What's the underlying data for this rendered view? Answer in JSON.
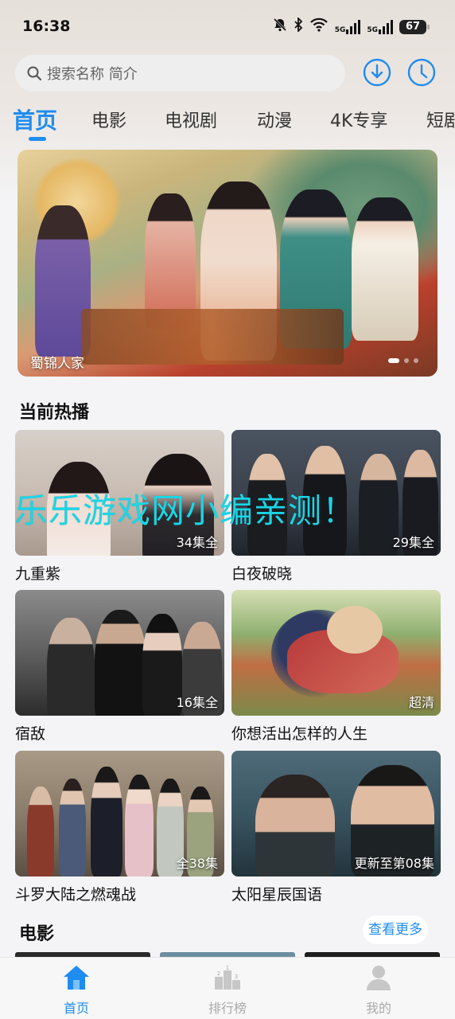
{
  "status_bar": {
    "time": "16:38",
    "net1": "5G",
    "net2": "5G",
    "battery": "67"
  },
  "search": {
    "placeholder": "搜索名称 简介"
  },
  "tabs": [
    {
      "label": "首页"
    },
    {
      "label": "电影"
    },
    {
      "label": "电视剧"
    },
    {
      "label": "动漫"
    },
    {
      "label": "4K专享"
    },
    {
      "label": "短剧"
    }
  ],
  "banner": {
    "caption": "蜀锦人家"
  },
  "section_hot": {
    "title": "当前热播"
  },
  "hot_items": [
    {
      "title": "九重紫",
      "badge": "34集全"
    },
    {
      "title": "白夜破晓",
      "badge": "29集全"
    },
    {
      "title": "宿敌",
      "badge": "16集全"
    },
    {
      "title": "你想活出怎样的人生",
      "badge": "超清"
    },
    {
      "title": "斗罗大陆之燃魂战",
      "badge": "全38集"
    },
    {
      "title": "太阳星辰国语",
      "badge": "更新至第08集"
    }
  ],
  "watermark": "乐乐游戏网小编亲测！",
  "section_movie": {
    "title": "电影",
    "more_label": "查看更多"
  },
  "bottom_nav": [
    {
      "label": "首页"
    },
    {
      "label": "排行榜"
    },
    {
      "label": "我的"
    }
  ],
  "colors": {
    "accent": "#1f8cf0"
  }
}
